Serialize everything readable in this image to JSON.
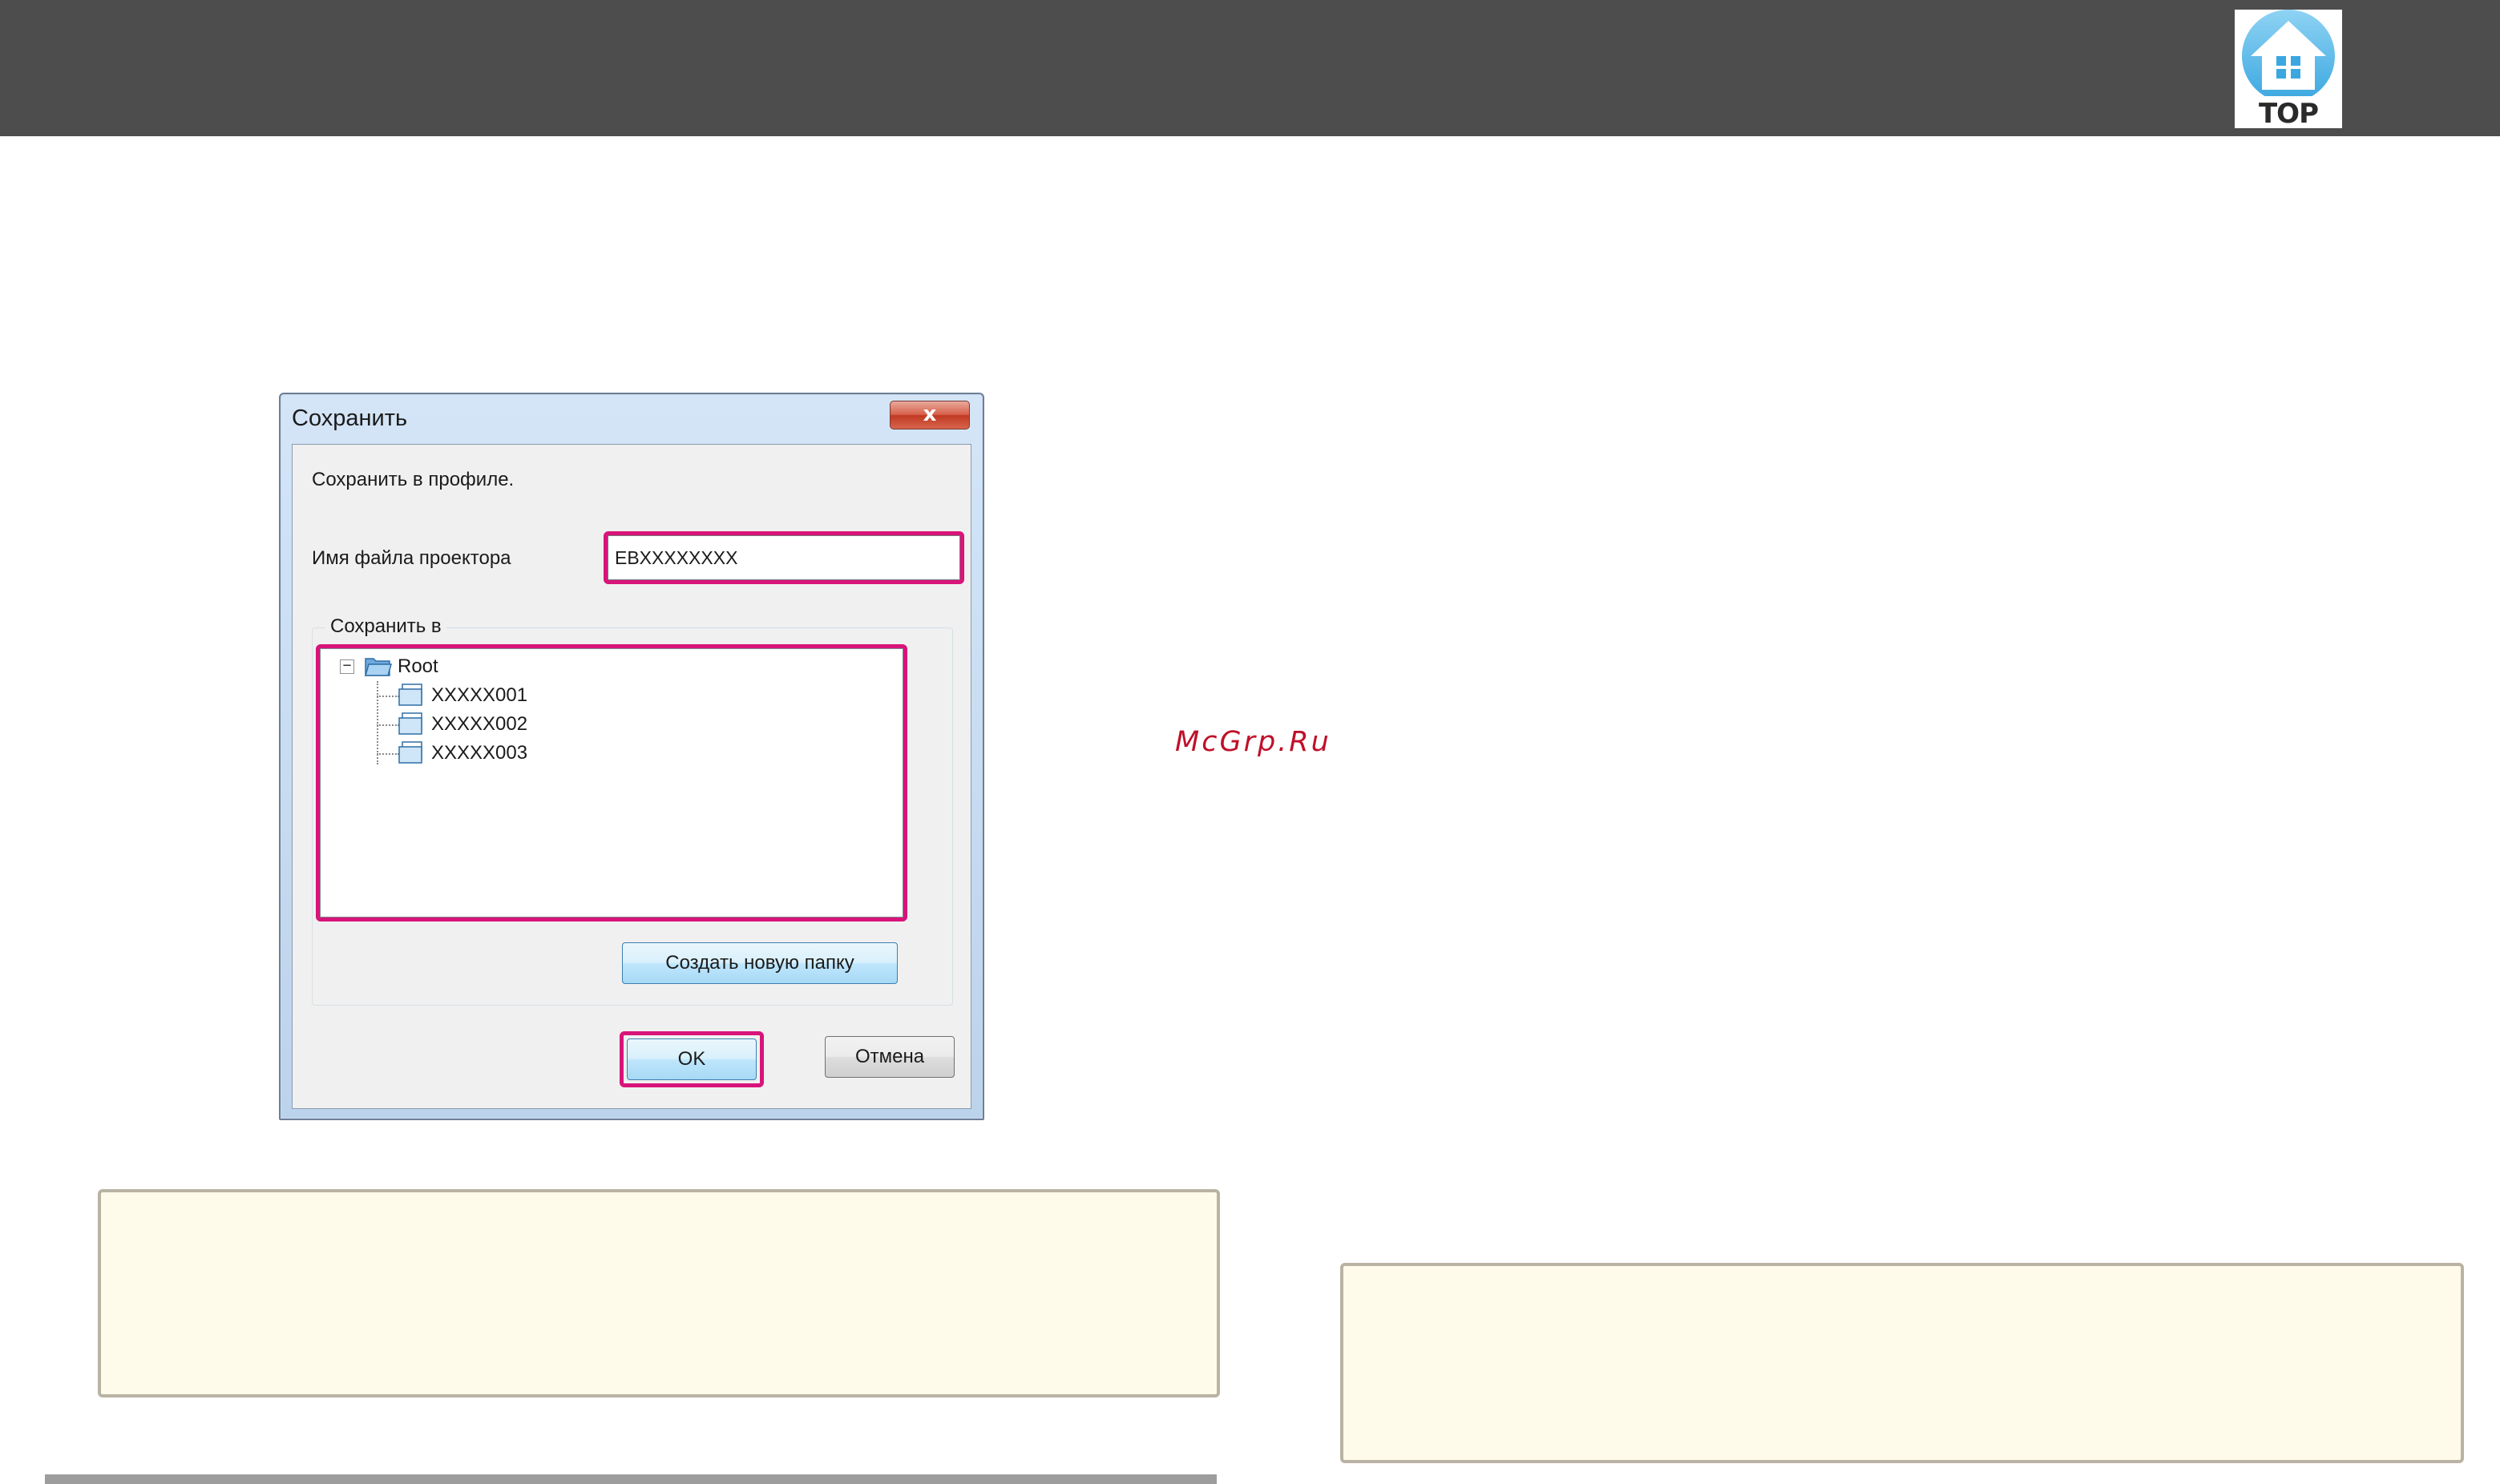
{
  "header": {
    "top_button_label": "TOP",
    "top_icon": "house-icon"
  },
  "dialog": {
    "title": "Сохранить",
    "close_label": "x",
    "intro_text": "Сохранить в профиле.",
    "filename_label": "Имя файла проектора",
    "filename_value": "EBXXXXXXXX",
    "group_label": "Сохранить в",
    "tree": {
      "root_label": "Root",
      "expander_symbol": "−",
      "children": [
        {
          "label": "XXXXX001"
        },
        {
          "label": "XXXXX002"
        },
        {
          "label": "XXXXX003"
        }
      ]
    },
    "new_folder_button": "Создать новую папку",
    "ok_button": "OK",
    "cancel_button": "Отмена",
    "highlight_color": "#d8147a"
  },
  "watermark": "McGrp.Ru"
}
